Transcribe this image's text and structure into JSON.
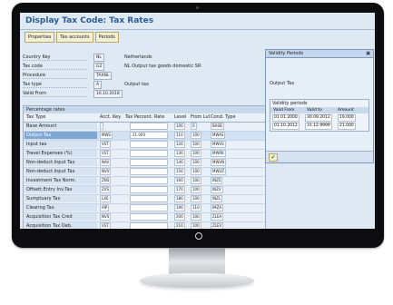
{
  "window": {
    "title": "Display Tax Code: Tax Rates"
  },
  "toolbar": {
    "buttons": [
      "Properties",
      "Tax accounts",
      "Periods"
    ]
  },
  "fields": [
    {
      "label": "Country Key",
      "value": "NL",
      "desc": "Netherlands"
    },
    {
      "label": "Tax code",
      "value": "G2",
      "desc": "NL Output tax goods domestic SR"
    },
    {
      "label": "Procedure",
      "value": "TAXNL",
      "desc": ""
    },
    {
      "label": "Tax type",
      "value": "A",
      "desc": "Output tax"
    },
    {
      "label": "Valid From",
      "value": "16.10.2018",
      "desc": ""
    }
  ],
  "rates_table": {
    "title": "Percentage rates",
    "columns": {
      "name": "Tax Type",
      "acct": "Acct. Key",
      "trky": "",
      "rate": "Tax Percent. Rate",
      "level": "Level",
      "from": "From Lvl",
      "ctype": "Cond. Type"
    },
    "rows": [
      {
        "name": "Base Amount",
        "acct": "",
        "rate": "",
        "level": "100",
        "from": "0",
        "ctype": "BASB",
        "selected": false
      },
      {
        "name": "Output Tax",
        "acct": "MWS",
        "rate": "21.000",
        "level": "110",
        "from": "100",
        "ctype": "MWAS",
        "selected": true
      },
      {
        "name": "Input tax",
        "acct": "VST",
        "rate": "",
        "level": "120",
        "from": "100",
        "ctype": "MWVS",
        "selected": false
      },
      {
        "name": "Travel Expenses (%)",
        "acct": "VST",
        "rate": "",
        "level": "130",
        "from": "100",
        "ctype": "MWRK",
        "selected": false
      },
      {
        "name": "Non-deduct.Input Tax",
        "acct": "NAV",
        "rate": "",
        "level": "140",
        "from": "100",
        "ctype": "MWVN",
        "selected": false
      },
      {
        "name": "Non-deduct.Input Tax",
        "acct": "NVV",
        "rate": "",
        "level": "150",
        "from": "100",
        "ctype": "MWVZ",
        "selected": false
      },
      {
        "name": "Investment Tax Norm.",
        "acct": "ZNS",
        "rate": "",
        "level": "160",
        "from": "100",
        "ctype": "INZS",
        "selected": false
      },
      {
        "name": "Offsett.Entry Inv.Tax",
        "acct": "ZVS",
        "rate": "",
        "level": "170",
        "from": "100",
        "ctype": "INZV",
        "selected": false
      },
      {
        "name": "Sumptuary Tax",
        "acct": "LXE",
        "rate": "",
        "level": "180",
        "from": "100",
        "ctype": "INZL",
        "selected": false
      },
      {
        "name": "Clearing Tax",
        "acct": "AIP",
        "rate": "",
        "level": "190",
        "from": "110",
        "ctype": "IMZA",
        "selected": false
      },
      {
        "name": "Acquisition Tax Cred",
        "acct": "NVS",
        "rate": "",
        "level": "200",
        "from": "100",
        "ctype": "ZLEA",
        "selected": false
      },
      {
        "name": "Acquisition Tax Deb.",
        "acct": "VST",
        "rate": "",
        "level": "210",
        "from": "100",
        "ctype": "ZLEV",
        "selected": false
      }
    ]
  },
  "validity_popup": {
    "title": "Validity Periods",
    "subtitle": "Output Tax",
    "box_title": "Validity periods",
    "columns": [
      "Valid From",
      "Valid to",
      "Amount"
    ],
    "rows": [
      {
        "from": "01.01.2000",
        "to": "30.09.2012",
        "amount": "19.000"
      },
      {
        "from": "01.10.2012",
        "to": "31.12.9999",
        "amount": "21.000"
      }
    ],
    "confirm_icon": "checkmark-icon"
  }
}
